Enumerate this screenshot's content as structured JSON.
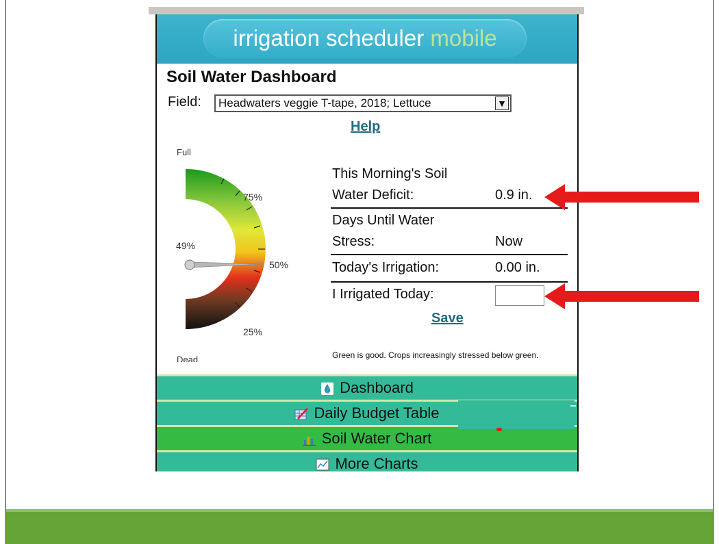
{
  "app": {
    "banner_main": "irrigation scheduler ",
    "banner_accent": "mobile"
  },
  "dashboard": {
    "title": "Soil Water Dashboard",
    "field_label": "Field:",
    "field_value": "Headwaters veggie T-tape, 2018; Lettuce",
    "help_link": "Help",
    "save_link": "Save",
    "note": "Green is good. Crops increasingly stressed below green."
  },
  "gauge": {
    "label_full": "Full",
    "label_dead": "Dead",
    "tick_75": "75%",
    "tick_50": "50%",
    "tick_25": "25%",
    "current_label": "49%",
    "current_value_percent": 49
  },
  "metrics": {
    "deficit_label_line1": "This Morning's Soil",
    "deficit_label_line2": "Water Deficit:",
    "deficit_value": "0.9 in.",
    "stress_label_line1": "Days Until Water",
    "stress_label_line2": "Stress:",
    "stress_value": "Now",
    "irrigation_label": "Today's Irrigation:",
    "irrigation_value": "0.00 in.",
    "irrigated_today_label": "I Irrigated Today:"
  },
  "nav": {
    "items": [
      {
        "label": "Dashboard",
        "icon": "droplet-leaf-icon"
      },
      {
        "label": "Daily Budget Table",
        "icon": "table-pencil-icon"
      },
      {
        "label": "Soil Water Chart",
        "icon": "bar-chart-icon"
      },
      {
        "label": "More Charts",
        "icon": "line-chart-icon"
      }
    ]
  },
  "colors": {
    "banner": "#2ea6c2",
    "nav_teal": "#33ba99",
    "nav_green": "#33bb44",
    "link": "#226b80",
    "annotation_arrow": "#e51b1b",
    "slide_band": "#65a538"
  }
}
